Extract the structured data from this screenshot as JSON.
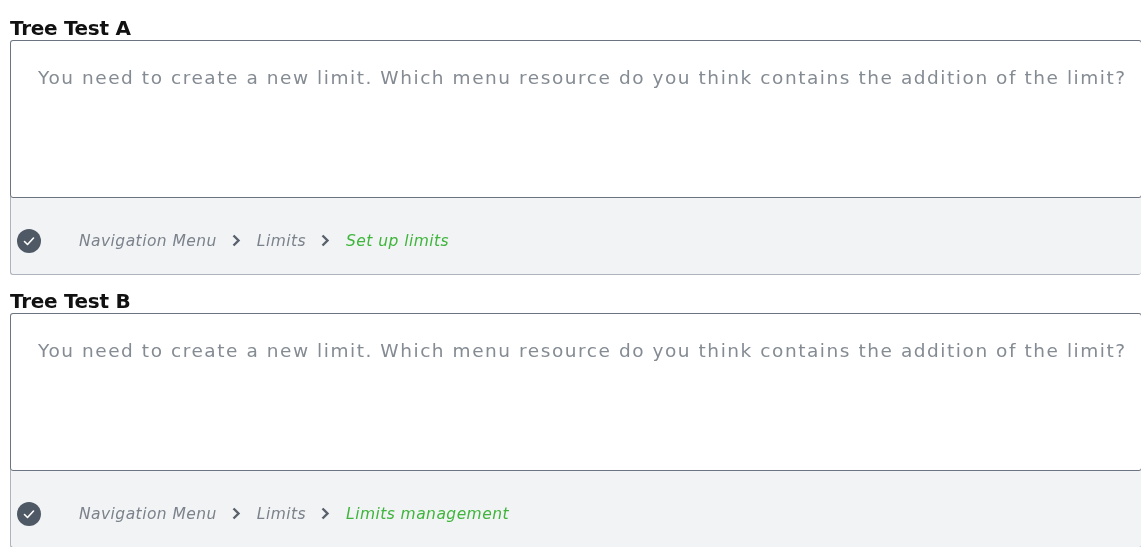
{
  "tests": [
    {
      "title": "Tree Test A",
      "question": "You need to create a new limit. Which menu resource do you think contains the addition of the limit?",
      "path": [
        {
          "label": "Navigation Menu",
          "selected": false
        },
        {
          "label": "Limits",
          "selected": false
        },
        {
          "label": "Set up limits",
          "selected": true
        }
      ]
    },
    {
      "title": "Tree Test B",
      "question": "You need to create a new limit. Which menu resource do you think contains the addition of the limit?",
      "path": [
        {
          "label": "Navigation Menu",
          "selected": false
        },
        {
          "label": "Limits",
          "selected": false
        },
        {
          "label": "Limits management",
          "selected": true
        }
      ]
    }
  ]
}
